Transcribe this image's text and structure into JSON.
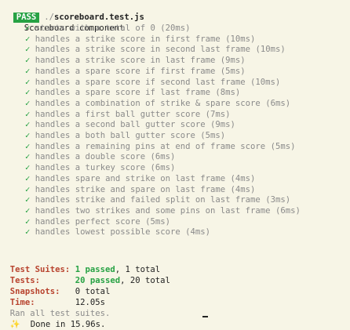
{
  "header": {
    "badge": "PASS",
    "path_dir": "./",
    "file": "scoreboard.test.js"
  },
  "suite": {
    "title": "Scoreboard component"
  },
  "tests": [
    {
      "name": "starts with a total of 0",
      "time": "(20ms)"
    },
    {
      "name": "handles a strike score in first frame",
      "time": "(10ms)"
    },
    {
      "name": "handles a strike score in second last frame",
      "time": "(10ms)"
    },
    {
      "name": "handles a strike score in last frame",
      "time": "(9ms)"
    },
    {
      "name": "handles a spare score if first frame",
      "time": "(5ms)"
    },
    {
      "name": "handles a spare score if second last frame",
      "time": "(10ms)"
    },
    {
      "name": "handles a spare score if last frame",
      "time": "(8ms)"
    },
    {
      "name": "handles a combination of strike & spare score",
      "time": "(6ms)"
    },
    {
      "name": "handles a first ball gutter score",
      "time": "(7ms)"
    },
    {
      "name": "handles a second ball gutter score",
      "time": "(9ms)"
    },
    {
      "name": "handles a both ball gutter score",
      "time": "(5ms)"
    },
    {
      "name": "handles a remaining pins at end of frame score",
      "time": "(5ms)"
    },
    {
      "name": "handles a double score",
      "time": "(6ms)"
    },
    {
      "name": "handles a turkey score",
      "time": "(6ms)"
    },
    {
      "name": "handles spare and strike on last frame",
      "time": "(4ms)"
    },
    {
      "name": "handles strike and spare on last frame",
      "time": "(4ms)"
    },
    {
      "name": "handles strike and failed split on last frame",
      "time": "(3ms)"
    },
    {
      "name": "handles two strikes and some pins on last frame",
      "time": "(6ms)"
    },
    {
      "name": "handles perfect score",
      "time": "(5ms)"
    },
    {
      "name": "handles lowest possible score",
      "time": "(4ms)"
    }
  ],
  "summary": {
    "suites_label": "Test Suites:",
    "suites_passed": "1 passed",
    "suites_total": ", 1 total",
    "tests_label": "Tests:",
    "tests_passed": "20 passed",
    "tests_total": ", 20 total",
    "snapshots_label": "Snapshots:",
    "snapshots_value": "0 total",
    "time_label": "Time:",
    "time_value": "12.05s",
    "ran_all": "Ran all test suites.",
    "done_icon": "✨",
    "done_text": "Done in 15.96s."
  },
  "colors": {
    "background": "#f7f5e6",
    "pass_badge": "#27a244",
    "check": "#27a244",
    "label": "#b8432e",
    "dim": "#8a8a8a"
  }
}
